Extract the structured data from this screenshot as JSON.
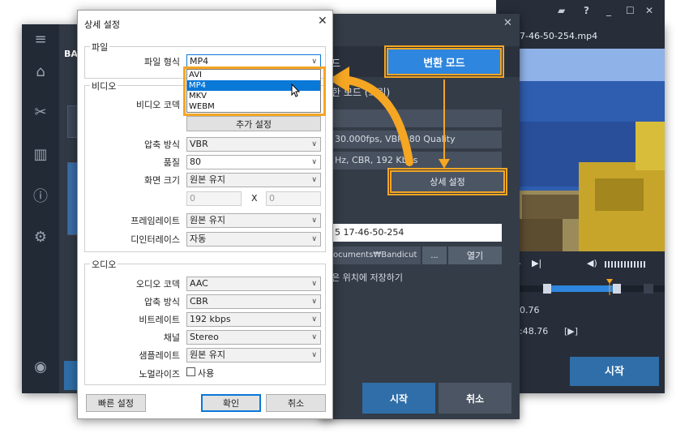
{
  "main_app": {
    "brand": "BA",
    "sidebar_icons": [
      "menu-icon",
      "home-icon",
      "tools-icon",
      "film-icon",
      "info-icon",
      "gear-icon",
      "record-icon"
    ]
  },
  "preview": {
    "filename": "17-46-50-254.mp4",
    "time_current": "10.76",
    "time_total": "0:48.76",
    "start_label": "시작"
  },
  "mid_dialog": {
    "tab_left": "드",
    "convert_mode": "변환 모드",
    "mode_desc": "한 모드 (느림)",
    "video_info": "30.000fps, VBR, 80 Quality",
    "audio_info": "Hz, CBR, 192 Kbps",
    "detail_settings": "상세 설정",
    "filename_value": "5 17-46-50-254",
    "folder_path": "ocuments₩Bandicut",
    "browse": "...",
    "open": "열기",
    "save_same": "은 위치에 저장하기",
    "start": "시작",
    "cancel": "취소"
  },
  "settings": {
    "title": "상세 설정",
    "groups": {
      "file": "파일",
      "video": "비디오",
      "audio": "오디오"
    },
    "file_format_label": "파일 형식",
    "file_format_value": "MP4",
    "format_options": [
      "AVI",
      "MP4",
      "MKV",
      "WEBM"
    ],
    "video": {
      "codec_label": "비디오 코덱",
      "advanced_button": "추가 설정",
      "compression_label": "압축 방식",
      "compression_value": "VBR",
      "quality_label": "품질",
      "quality_value": "80",
      "size_label": "화면 크기",
      "size_value": "원본 유지",
      "width_value": "0",
      "x_label": "X",
      "height_value": "0",
      "framerate_label": "프레임레이트",
      "framerate_value": "원본 유지",
      "deinterlace_label": "디인터레이스",
      "deinterlace_value": "자동"
    },
    "audio": {
      "codec_label": "오디오 코덱",
      "codec_value": "AAC",
      "compression_label": "압축 방식",
      "compression_value": "CBR",
      "bitrate_label": "비트레이트",
      "bitrate_value": "192 kbps",
      "channel_label": "채널",
      "channel_value": "Stereo",
      "samplerate_label": "샘플레이트",
      "samplerate_value": "원본 유지",
      "normalize_label": "노멀라이즈",
      "normalize_check": "사용"
    },
    "quick_settings": "빠른 설정",
    "ok": "확인",
    "cancel": "취소"
  },
  "colors": {
    "accent_orange": "#f5a623",
    "primary_blue": "#2e86de",
    "dark_bg": "#313946"
  }
}
